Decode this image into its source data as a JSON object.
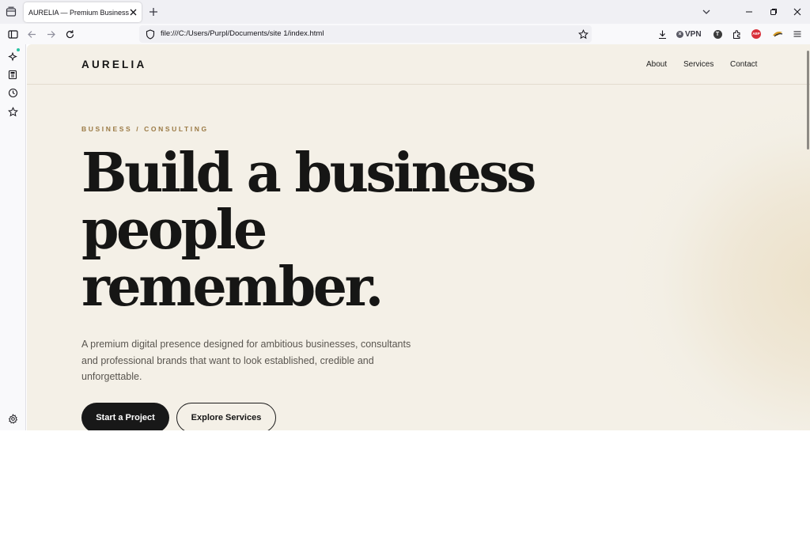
{
  "browser": {
    "tab_title": "AURELIA — Premium Business",
    "url": "file:///C:/Users/Purpl/Documents/site 1/index.html",
    "vpn_label": "VPN",
    "extension_t_label": "T",
    "extension_abp_label": "ABP"
  },
  "site": {
    "logo": "AURELIA",
    "nav": [
      "About",
      "Services",
      "Contact"
    ]
  },
  "hero": {
    "kicker": "BUSINESS / CONSULTING",
    "headline_lines": [
      "Build a business",
      "people",
      "remember."
    ],
    "lead": "A premium digital presence designed for ambitious businesses, consultants and professional brands that want to look established, credible and unforgettable.",
    "primary_cta": "Start a Project",
    "secondary_cta": "Explore Services"
  },
  "colors": {
    "page_bg": "#f4f0e7",
    "accent_gold": "#9b7a45",
    "ink": "#161615",
    "browser_chrome": "#f0f0f4"
  }
}
